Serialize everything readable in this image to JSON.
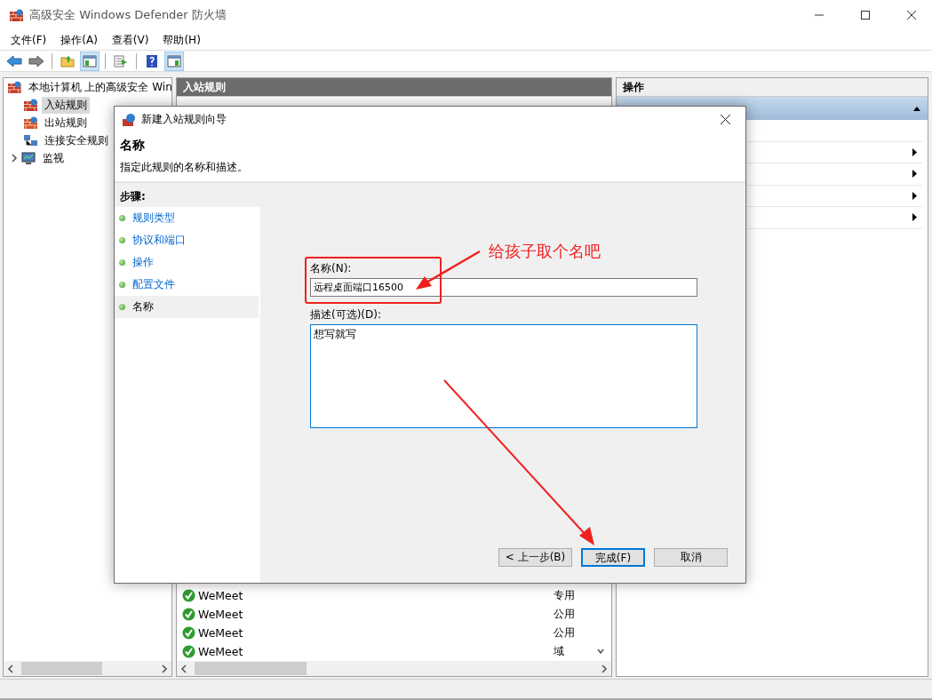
{
  "window": {
    "title": "高级安全 Windows Defender 防火墙"
  },
  "menu": [
    "文件(F)",
    "操作(A)",
    "查看(V)",
    "帮助(H)"
  ],
  "toolbar": [
    {
      "kind": "back",
      "pressed": false
    },
    {
      "kind": "forward",
      "pressed": false
    },
    {
      "kind": "sep"
    },
    {
      "kind": "up",
      "pressed": false
    },
    {
      "kind": "tree",
      "pressed": true
    },
    {
      "kind": "sep"
    },
    {
      "kind": "export",
      "pressed": false
    },
    {
      "kind": "sep"
    },
    {
      "kind": "help",
      "pressed": false
    },
    {
      "kind": "pane",
      "pressed": true
    }
  ],
  "tree": {
    "label": "本地计算机 上的高级安全 Win",
    "children": [
      {
        "label": "入站规则",
        "kind": "inbound",
        "selected": true
      },
      {
        "label": "出站规则",
        "kind": "outbound",
        "selected": false
      },
      {
        "label": "连接安全规则",
        "kind": "security",
        "selected": false
      },
      {
        "label": "监视",
        "kind": "monitor",
        "selected": false,
        "expanded": false
      }
    ]
  },
  "center": {
    "title": "入站规则",
    "rows": [
      {
        "name": "WeMeet",
        "profile": "专用",
        "enabled": true
      },
      {
        "name": "WeMeet",
        "profile": "公用",
        "enabled": true
      },
      {
        "name": "WeMeet",
        "profile": "公用",
        "enabled": true
      },
      {
        "name": "WeMeet",
        "profile": "域",
        "enabled": true
      }
    ]
  },
  "actions": {
    "title": "操作",
    "items": [
      {
        "kind": "section",
        "expanded": true
      },
      {
        "kind": "plain"
      },
      {
        "kind": "submenu"
      },
      {
        "kind": "submenu"
      },
      {
        "kind": "submenu"
      },
      {
        "kind": "submenu"
      }
    ]
  },
  "dialog": {
    "title": "新建入站规则向导",
    "heading": "名称",
    "subtitle": "指定此规则的名称和描述。",
    "steps_title": "步骤:",
    "steps": [
      {
        "label": "规则类型",
        "selected": false
      },
      {
        "label": "协议和端口",
        "selected": false
      },
      {
        "label": "操作",
        "selected": false
      },
      {
        "label": "配置文件",
        "selected": false
      },
      {
        "label": "名称",
        "selected": true
      }
    ],
    "name_label": "名称(N):",
    "name_value": "远程桌面端口16500",
    "description_label": "描述(可选)(D):",
    "description_value": "想写就写",
    "buttons": [
      {
        "label": "< 上一步(B)",
        "default": false
      },
      {
        "label": "完成(F)",
        "default": true
      },
      {
        "label": "取消",
        "default": false
      }
    ]
  },
  "annotation": {
    "text": "给孩子取个名吧"
  }
}
